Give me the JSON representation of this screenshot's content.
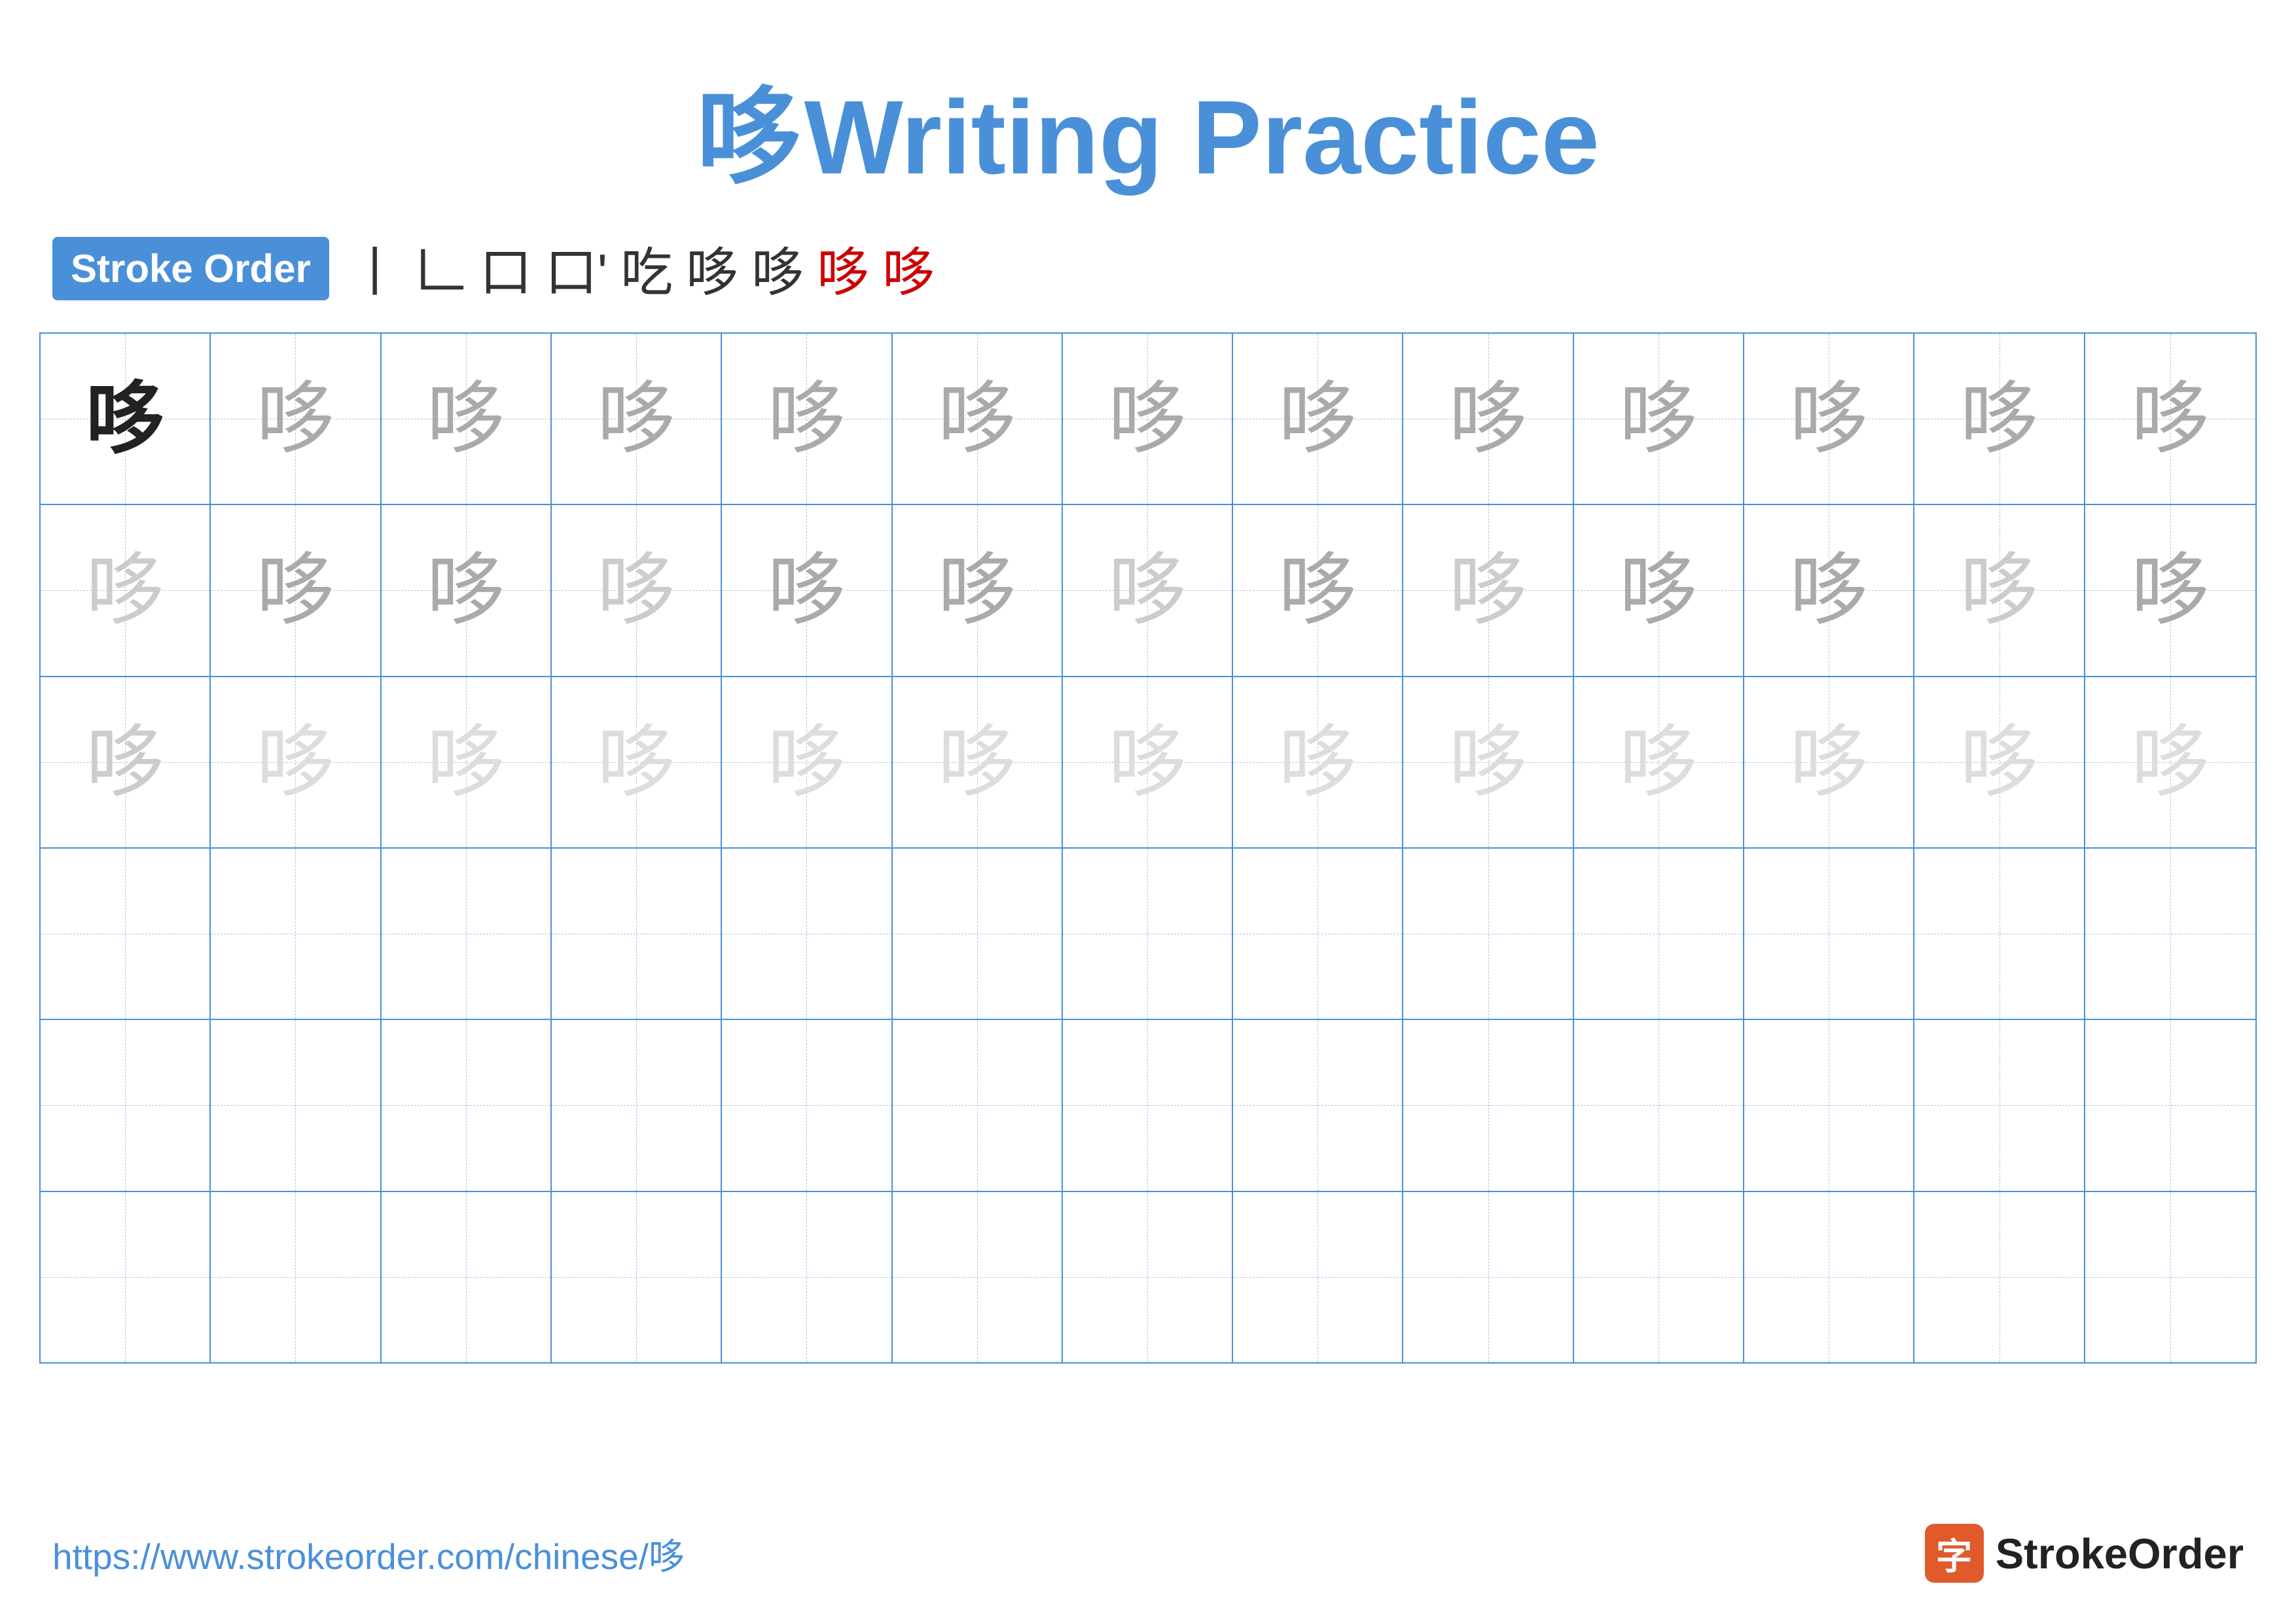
{
  "title": {
    "char": "哆",
    "label": "Writing Practice"
  },
  "stroke_order": {
    "badge": "Stroke Order",
    "steps": [
      "丨",
      "𠃊",
      "口",
      "口´",
      "吃",
      "哆",
      "哆",
      "哆",
      "哆"
    ]
  },
  "grid": {
    "rows": 6,
    "cols": 13,
    "char": "哆",
    "row_styles": [
      [
        "dark",
        "medium",
        "medium",
        "medium",
        "medium",
        "medium",
        "medium",
        "medium",
        "medium",
        "medium",
        "medium",
        "medium",
        "medium"
      ],
      [
        "light",
        "medium",
        "medium",
        "medium",
        "medium",
        "medium",
        "medium",
        "medium",
        "medium",
        "medium",
        "medium",
        "medium",
        "medium"
      ],
      [
        "light",
        "light",
        "light",
        "light",
        "light",
        "light",
        "light",
        "light",
        "light",
        "light",
        "light",
        "light",
        "light"
      ],
      [
        "empty",
        "empty",
        "empty",
        "empty",
        "empty",
        "empty",
        "empty",
        "empty",
        "empty",
        "empty",
        "empty",
        "empty",
        "empty"
      ],
      [
        "empty",
        "empty",
        "empty",
        "empty",
        "empty",
        "empty",
        "empty",
        "empty",
        "empty",
        "empty",
        "empty",
        "empty",
        "empty"
      ],
      [
        "empty",
        "empty",
        "empty",
        "empty",
        "empty",
        "empty",
        "empty",
        "empty",
        "empty",
        "empty",
        "empty",
        "empty",
        "empty"
      ]
    ]
  },
  "footer": {
    "url": "https://www.strokeorder.com/chinese/哆",
    "logo_char": "字",
    "logo_text": "StrokeOrder"
  }
}
